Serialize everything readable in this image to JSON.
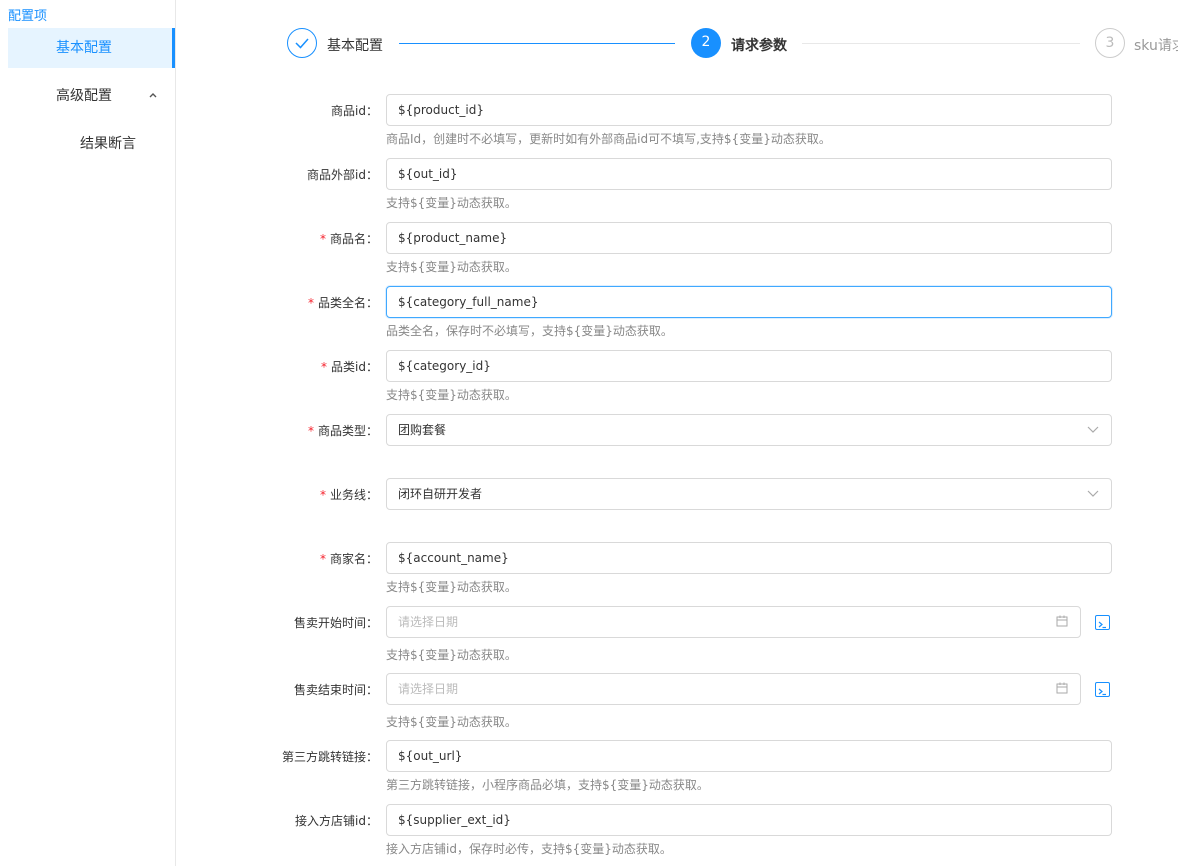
{
  "sidebar": {
    "title": "配置项",
    "items": [
      {
        "label": "基本配置"
      },
      {
        "label": "高级配置",
        "caret": "^"
      },
      {
        "label": "结果断言"
      }
    ]
  },
  "steps": [
    {
      "title": "基本配置",
      "status": "finish",
      "icon": "check-icon"
    },
    {
      "number": "2",
      "title": "请求参数",
      "status": "process"
    },
    {
      "number": "3",
      "title": "sku请求参数",
      "status": "wait"
    }
  ],
  "form": {
    "fields": [
      {
        "label": "商品id：",
        "required": false,
        "value": "${product_id}",
        "help": "商品Id，创建时不必填写，更新时如有外部商品id可不填写,支持${变量}动态获取。"
      },
      {
        "label": "商品外部id：",
        "required": false,
        "value": "${out_id}",
        "help": "支持${变量}动态获取。"
      },
      {
        "label": "商品名：",
        "required": true,
        "value": "${product_name}",
        "help": "支持${变量}动态获取。"
      },
      {
        "label": "品类全名：",
        "required": true,
        "value": "${category_full_name}",
        "help": "品类全名，保存时不必填写，支持${变量}动态获取。"
      },
      {
        "label": "品类id：",
        "required": true,
        "value": "${category_id}",
        "help": "支持${变量}动态获取。"
      },
      {
        "label": "商品类型：",
        "required": true,
        "value": "团购套餐",
        "type": "select"
      },
      {
        "label": "业务线：",
        "required": true,
        "value": "闭环自研开发者",
        "type": "select"
      },
      {
        "label": "商家名：",
        "required": true,
        "value": "${account_name}",
        "help": "支持${变量}动态获取。"
      },
      {
        "label": "售卖开始时间：",
        "required": false,
        "placeholder": "请选择日期",
        "type": "date",
        "help": "支持${变量}动态获取。"
      },
      {
        "label": "售卖结束时间：",
        "required": false,
        "placeholder": "请选择日期",
        "type": "date",
        "help": "支持${变量}动态获取。"
      },
      {
        "label": "第三方跳转链接：",
        "required": false,
        "value": "${out_url}",
        "help": "第三方跳转链接，小程序商品必填，支持${变量}动态获取。"
      },
      {
        "label": "接入方店铺id：",
        "required": false,
        "value": "${supplier_ext_id}",
        "help": "接入方店铺id，保存时必传，支持${变量}动态获取。"
      }
    ]
  },
  "colors": {
    "primary": "#1890ff",
    "required": "#f5222d",
    "help": "#888888",
    "border": "#d9d9d9"
  }
}
